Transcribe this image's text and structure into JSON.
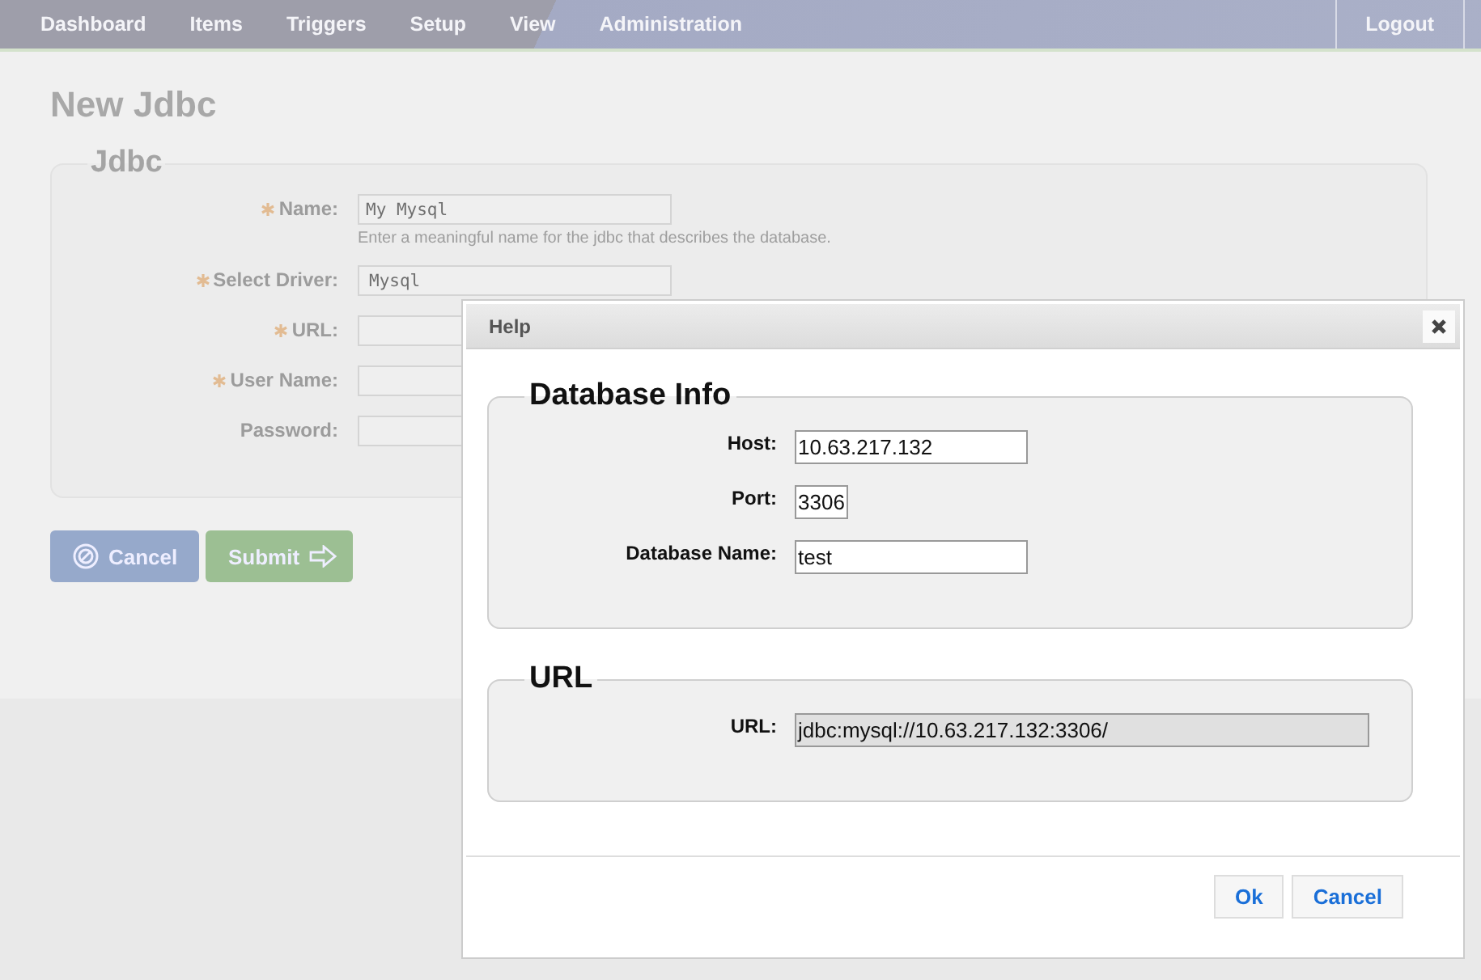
{
  "nav": {
    "items": [
      {
        "label": "Dashboard"
      },
      {
        "label": "Items"
      },
      {
        "label": "Triggers"
      },
      {
        "label": "Setup"
      },
      {
        "label": "View"
      },
      {
        "label": "Administration"
      }
    ],
    "logout": "Logout"
  },
  "page": {
    "title": "New Jdbc"
  },
  "form": {
    "legend": "Jdbc",
    "fields": [
      {
        "label": "Name:",
        "required": true,
        "kind": "text",
        "value": "My Mysql",
        "hint": "Enter a meaningful name for the jdbc that describes the database."
      },
      {
        "label": "Select Driver:",
        "required": true,
        "kind": "select",
        "value": "Mysql"
      },
      {
        "label": "URL:",
        "required": true,
        "kind": "text"
      },
      {
        "label": "User Name:",
        "required": true,
        "kind": "text"
      },
      {
        "label": "Password:",
        "required": false,
        "kind": "text"
      }
    ],
    "buttons": [
      {
        "kind": "cancel",
        "label": "Cancel"
      },
      {
        "kind": "submit",
        "label": "Submit"
      }
    ]
  },
  "dialog": {
    "title": "Help",
    "sections": [
      {
        "legend": "Database Info",
        "fields": [
          {
            "label": "Host:",
            "kind": "text",
            "value": "10.63.217.132"
          },
          {
            "label": "Port:",
            "kind": "short",
            "value": "3306"
          },
          {
            "label": "Database Name:",
            "kind": "text",
            "value": "test"
          }
        ]
      },
      {
        "legend": "URL",
        "fields": [
          {
            "label": "URL:",
            "kind": "readonly",
            "value": "jdbc:mysql://10.63.217.132:3306/"
          }
        ]
      }
    ],
    "buttons": [
      {
        "label": "Ok"
      },
      {
        "label": "Cancel"
      }
    ]
  }
}
